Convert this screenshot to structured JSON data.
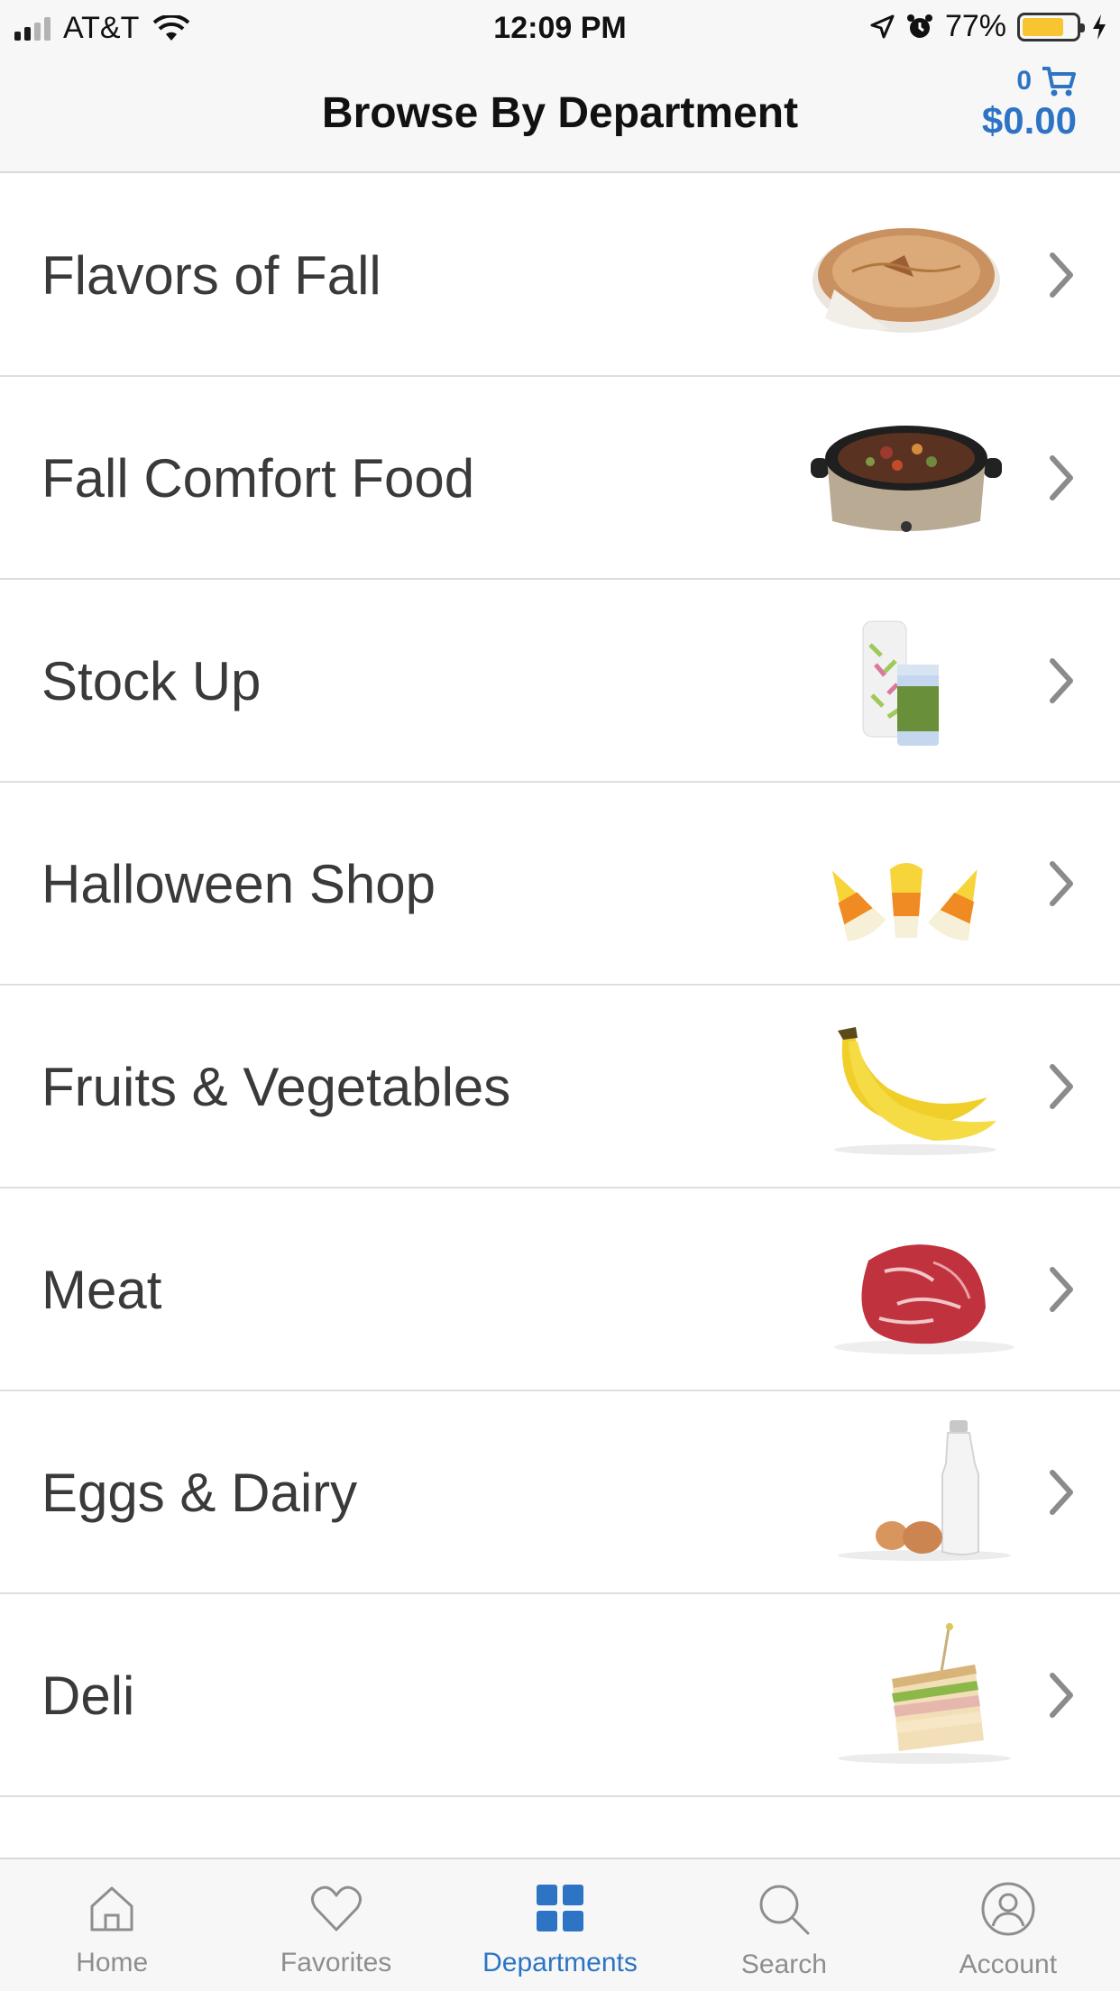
{
  "status_bar": {
    "carrier": "AT&T",
    "time": "12:09 PM",
    "battery": "77%",
    "battery_level": 0.77,
    "battery_color": "#f6c531"
  },
  "nav": {
    "title": "Browse By Department",
    "cart_count": "0",
    "cart_total": "$0.00",
    "accent": "#2d74c4"
  },
  "departments": [
    {
      "label": "Flavors of Fall",
      "image": "pie"
    },
    {
      "label": "Fall Comfort Food",
      "image": "slow-cooker"
    },
    {
      "label": "Stock Up",
      "image": "paper-towels-and-can"
    },
    {
      "label": "Halloween Shop",
      "image": "candy-corn"
    },
    {
      "label": "Fruits & Vegetables",
      "image": "bananas"
    },
    {
      "label": "Meat",
      "image": "beef"
    },
    {
      "label": "Eggs & Dairy",
      "image": "milk-and-eggs"
    },
    {
      "label": "Deli",
      "image": "sandwich"
    }
  ],
  "tabs": [
    {
      "label": "Home",
      "icon": "home-icon",
      "active": false
    },
    {
      "label": "Favorites",
      "icon": "heart-icon",
      "active": false
    },
    {
      "label": "Departments",
      "icon": "grid-icon",
      "active": true
    },
    {
      "label": "Search",
      "icon": "search-icon",
      "active": false
    },
    {
      "label": "Account",
      "icon": "user-icon",
      "active": false
    }
  ]
}
